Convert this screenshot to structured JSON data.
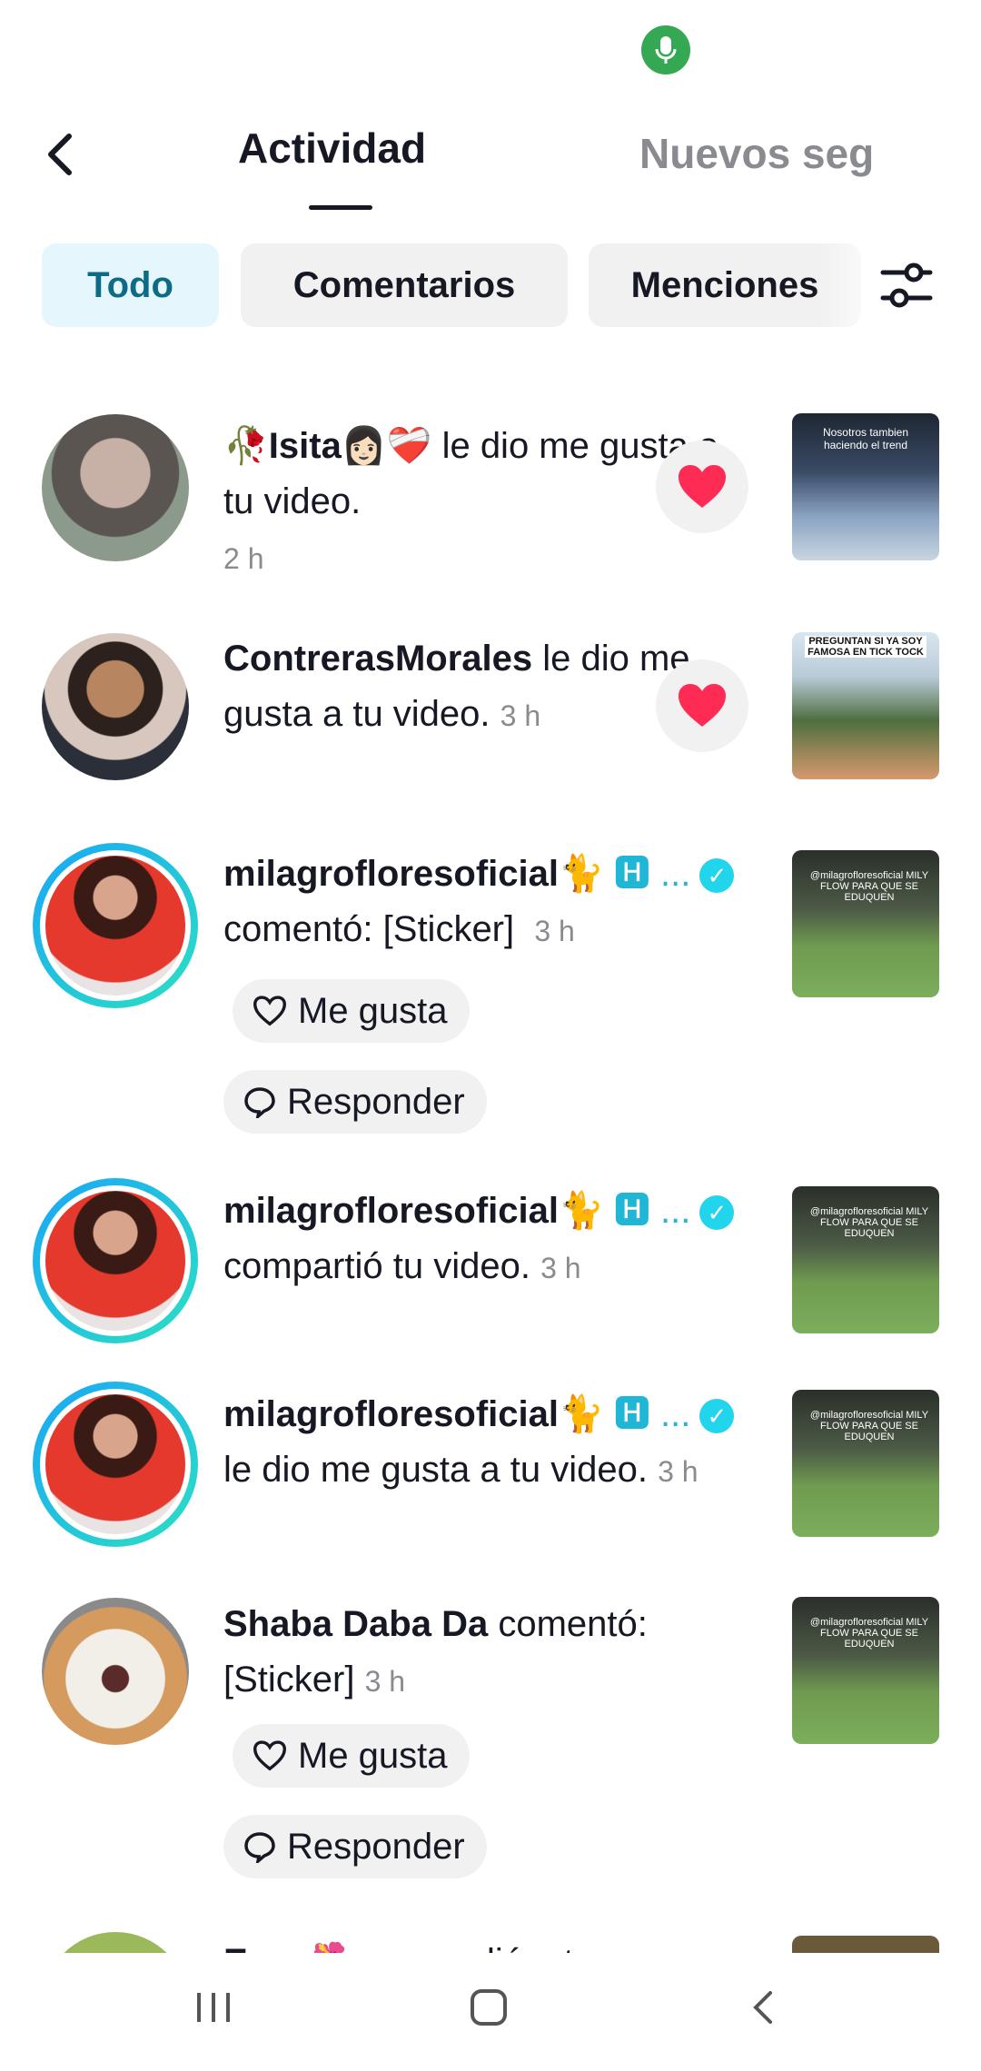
{
  "header": {
    "tab_active": "Actividad",
    "tab_inactive": "Nuevos seg"
  },
  "filters": {
    "chips": [
      "Todo",
      "Comentarios",
      "Menciones"
    ]
  },
  "notifications": [
    {
      "name": "🥀Isita👩🏻❤️‍🩹",
      "action": " le dio me gusta a tu video.",
      "time": "2 h"
    },
    {
      "name": "ContrerasMorales",
      "action": " le dio me gusta a tu video.",
      "time": "3 h"
    },
    {
      "name": "milagrofloresoficial🐈",
      "name_suffix": "🅷 ...",
      "action": "comentó: [Sticker]",
      "time": "3 h",
      "like_label": "Me gusta",
      "reply_label": "Responder"
    },
    {
      "name": "milagrofloresoficial🐈",
      "name_suffix": "🅷 ...",
      "action": "compartió tu video.",
      "time": "3 h"
    },
    {
      "name": "milagrofloresoficial🐈",
      "name_suffix": "🅷 ...",
      "action": "le dio me gusta a tu video.",
      "time": "3 h"
    },
    {
      "name": "Shaba Daba Da",
      "action": " comentó: [Sticker]",
      "time": "3 h",
      "like_label": "Me gusta",
      "reply_label": "Responder"
    },
    {
      "name": "Exsy🌺",
      "action": " respondió a tu"
    }
  ],
  "thumbs": {
    "t1": "Nosotros tambien haciendo el trend",
    "t2": "PREGUNTAN SI YA SOY FAMOSA EN TICK TOCK",
    "t3": "@milagrofloresoficial MILY FLOW PARA QUE SE EDUQUEN"
  },
  "colors": {
    "accent": "#20d5ec",
    "heart": "#fe2c55",
    "chip_active_bg": "#e5f7fc"
  }
}
